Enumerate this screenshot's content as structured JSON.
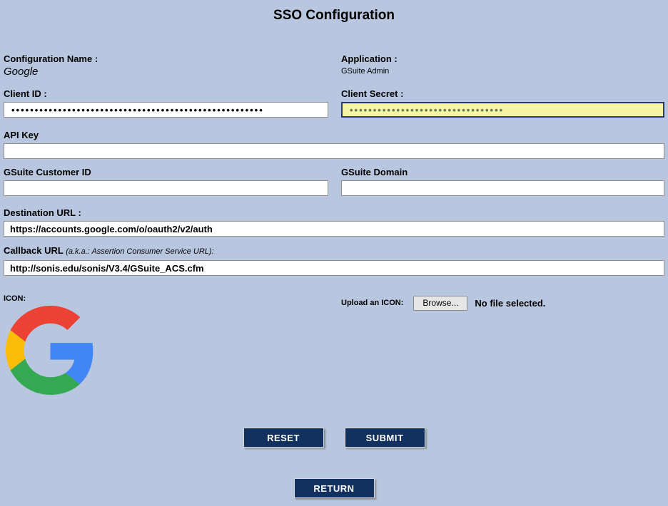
{
  "page": {
    "title": "SSO Configuration"
  },
  "fields": {
    "configuration_name": {
      "label": "Configuration Name :",
      "value": "Google"
    },
    "application": {
      "label": "Application :",
      "value": "GSuite Admin"
    },
    "client_id": {
      "label": "Client ID :",
      "masked_value": "••••••••••••••••••••••••••••••••••••••••••••••••••••••"
    },
    "client_secret": {
      "label": "Client Secret :",
      "masked_value": "•••••••••••••••••••••••••••••••••"
    },
    "api_key": {
      "label": "API Key",
      "value": ""
    },
    "gsuite_customer_id": {
      "label": "GSuite Customer ID",
      "value": ""
    },
    "gsuite_domain": {
      "label": "GSuite Domain",
      "value": ""
    },
    "destination_url": {
      "label": "Destination URL :",
      "value": "https://accounts.google.com/o/oauth2/v2/auth"
    },
    "callback_url": {
      "label": "Callback URL",
      "label_note": "(a.k.a.: Assertion Consumer Service URL):",
      "value": "http://sonis.edu/sonis/V3.4/GSuite_ACS.cfm"
    }
  },
  "icon_section": {
    "label": "ICON:",
    "icon_name": "google-logo",
    "upload_label": "Upload an ICON:",
    "browse_button_label": "Browse...",
    "file_status": "No file selected."
  },
  "buttons": {
    "reset": "RESET",
    "submit": "SUBMIT",
    "return": "RETURN"
  },
  "colors": {
    "background": "#b8c7df",
    "button_navy": "#12315f",
    "button_text": "#ffffff",
    "secret_field_bg": "#f5f5a5",
    "secret_field_border": "#2a3a6e",
    "google_red": "#EA4335",
    "google_blue": "#4285F4",
    "google_yellow": "#FBBC05",
    "google_green": "#34A853"
  }
}
